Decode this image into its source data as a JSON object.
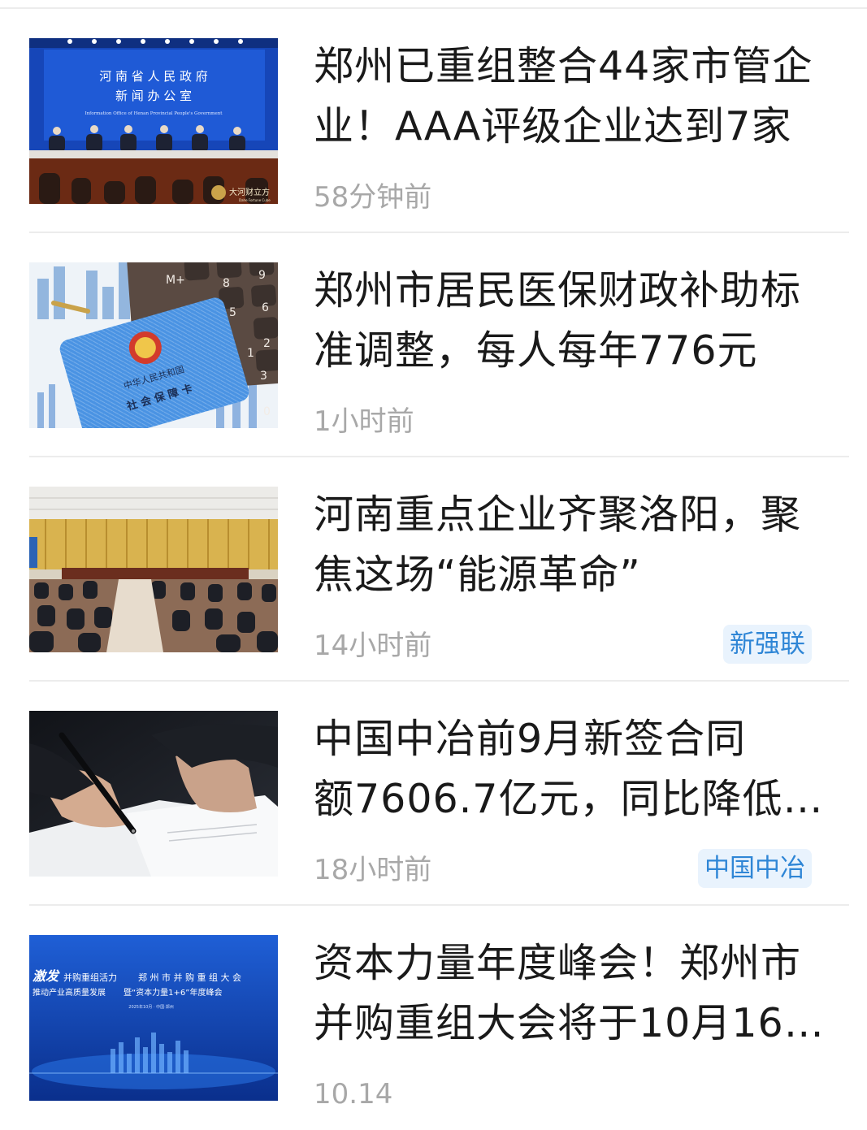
{
  "news": [
    {
      "title_lines": [
        "郑州已重组整合44家市管企",
        "业！AAA评级企业达到7家"
      ],
      "time": "58分钟前",
      "tag": "",
      "thumb_texts": [
        "河 南 省 人 民 政 府",
        "新 闻 办 公 室",
        "Information Office of Henan Provincial People's Government",
        "大河财立方",
        "Dahe Fortune Cube"
      ]
    },
    {
      "title_lines": [
        "郑州市居民医保财政补助标",
        "准调整，每人每年776元"
      ],
      "time": "1小时前",
      "tag": "",
      "thumb_texts": [
        "中华人民共和国",
        "社 会 保 障 卡",
        "M+",
        "8",
        "9",
        "5",
        "6",
        "2",
        "3",
        "0",
        "1"
      ]
    },
    {
      "title_lines": [
        "河南重点企业齐聚洛阳，聚",
        "焦这场“能源革命”"
      ],
      "time": "14小时前",
      "tag": "新强联",
      "thumb_texts": []
    },
    {
      "title_lines": [
        "中国中冶前9月新签合同",
        "额7606.7亿元，同比降低14.3%"
      ],
      "time": "18小时前",
      "tag": "中国中冶",
      "thumb_texts": []
    },
    {
      "title_lines": [
        "资本力量年度峰会！郑州市",
        "并购重组大会将于10月16日召开"
      ],
      "time": "10.14",
      "tag": "",
      "thumb_texts": [
        "激发",
        "并购重组活力",
        "郑 州 市 并 购 重 组 大 会",
        "推动产业高质量发展",
        "暨“资本力量1+6”年度峰会",
        "2025年10月 · 中国·郑州"
      ]
    }
  ]
}
